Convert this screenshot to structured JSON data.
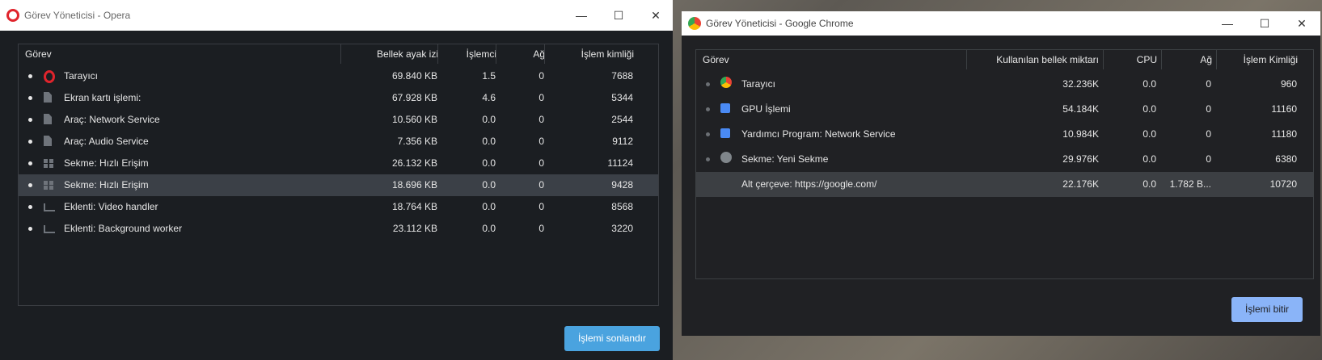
{
  "opera": {
    "title": "Görev Yöneticisi - Opera",
    "columns": [
      "Görev",
      "Bellek ayak izi",
      "İşlemci",
      "Ağ",
      "İşlem kimliği"
    ],
    "rows": [
      {
        "name": "Tarayıcı",
        "icon": "opera-icon",
        "mem": "69.840 KB",
        "cpu": "1.5",
        "net": "0",
        "pid": "7688"
      },
      {
        "name": "Ekran kartı işlemi:",
        "icon": "document-icon",
        "mem": "67.928 KB",
        "cpu": "4.6",
        "net": "0",
        "pid": "5344"
      },
      {
        "name": "Araç: Network Service",
        "icon": "document-icon",
        "mem": "10.560 KB",
        "cpu": "0.0",
        "net": "0",
        "pid": "2544"
      },
      {
        "name": "Araç: Audio Service",
        "icon": "document-icon",
        "mem": "7.356 KB",
        "cpu": "0.0",
        "net": "0",
        "pid": "9112"
      },
      {
        "name": "Sekme: Hızlı Erişim",
        "icon": "grid-icon",
        "mem": "26.132 KB",
        "cpu": "0.0",
        "net": "0",
        "pid": "11124"
      },
      {
        "name": "Sekme: Hızlı Erişim",
        "icon": "grid-icon",
        "mem": "18.696 KB",
        "cpu": "0.0",
        "net": "0",
        "pid": "9428",
        "selected": true
      },
      {
        "name": "Eklenti: Video handler",
        "icon": "extension-icon",
        "mem": "18.764 KB",
        "cpu": "0.0",
        "net": "0",
        "pid": "8568"
      },
      {
        "name": "Eklenti: Background worker",
        "icon": "extension-icon",
        "mem": "23.112 KB",
        "cpu": "0.0",
        "net": "0",
        "pid": "3220"
      }
    ],
    "end_button": "İşlemi sonlandır",
    "accent": "#4aa3df",
    "bg": "#1b1e22"
  },
  "chrome": {
    "title": "Görev Yöneticisi - Google Chrome",
    "columns": [
      "Görev",
      "Kullanılan bellek miktarı",
      "CPU",
      "Ağ",
      "İşlem Kimliği"
    ],
    "rows": [
      {
        "name": "Tarayıcı",
        "icon": "chrome-icon",
        "mem": "32.236K",
        "cpu": "0.0",
        "net": "0",
        "pid": "960"
      },
      {
        "name": "GPU İşlemi",
        "icon": "puzzle-icon",
        "mem": "54.184K",
        "cpu": "0.0",
        "net": "0",
        "pid": "11160"
      },
      {
        "name": "Yardımcı Program: Network Service",
        "icon": "puzzle-icon",
        "mem": "10.984K",
        "cpu": "0.0",
        "net": "0",
        "pid": "11180"
      },
      {
        "name": "Sekme: Yeni Sekme",
        "icon": "globe-icon",
        "mem": "29.976K",
        "cpu": "0.0",
        "net": "0",
        "pid": "6380"
      },
      {
        "name": "Alt çerçeve: https://google.com/",
        "icon": "",
        "mem": "22.176K",
        "cpu": "0.0",
        "net": "1.782 B...",
        "pid": "10720",
        "selected": true
      }
    ],
    "end_button": "İşlemi bitir",
    "accent": "#8ab4f8",
    "bg": "#202124"
  }
}
